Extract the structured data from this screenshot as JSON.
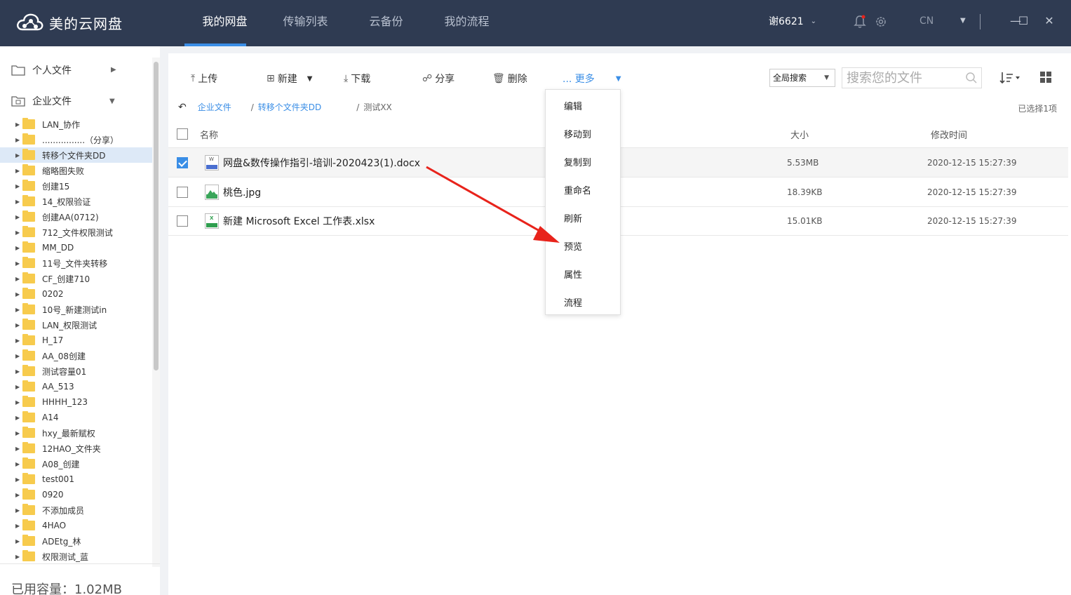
{
  "app": {
    "title": "美的云网盘"
  },
  "nav": [
    {
      "label": "我的网盘",
      "active": true
    },
    {
      "label": "传输列表",
      "active": false
    },
    {
      "label": "云备份",
      "active": false
    },
    {
      "label": "我的流程",
      "active": false
    }
  ],
  "user": {
    "name": "谢6621",
    "lang": "CN"
  },
  "sidebar": {
    "personal": "个人文件",
    "enterprise": "企业文件",
    "folders": [
      "LAN_协作",
      "................（分享）",
      "转移个文件夹DD",
      "缩略图失败",
      "创建15",
      "14_权限验证",
      "创建AA(0712)",
      "712_文件权限测试",
      "MM_DD",
      "11号_文件夹转移",
      "CF_创建710",
      "0202",
      "10号_新建测试in",
      "LAN_权限测试",
      "H_17",
      "AA_08创建",
      "测试容量01",
      "AA_513",
      "HHHH_123",
      "A14",
      "hxy_最新赋权",
      "12HAO_文件夹",
      "A08_创建",
      "test001",
      "0920",
      "不添加成员",
      "4HAO",
      "ADEtg_林",
      "权限测试_蓝"
    ],
    "selected_index": 2,
    "storage": "已用容量：1.02MB"
  },
  "toolbar": {
    "upload": "上传",
    "new": "新建",
    "download": "下载",
    "share": "分享",
    "delete": "删除",
    "more": "... 更多",
    "search_scope": "全局搜索",
    "search_placeholder": "搜索您的文件"
  },
  "breadcrumb": {
    "items": [
      "企业文件",
      "转移个文件夹DD",
      "测试XX"
    ]
  },
  "selected_count": "已选择1项",
  "table": {
    "headers": {
      "name": "名称",
      "size": "大小",
      "modified": "修改时间"
    },
    "rows": [
      {
        "name": "网盘&数传操作指引-培训-2020423(1).docx",
        "size": "5.53MB",
        "modified": "2020-12-15 15:27:39",
        "type": "doc",
        "checked": true
      },
      {
        "name": "桃色.jpg",
        "size": "18.39KB",
        "modified": "2020-12-15 15:27:39",
        "type": "jpg",
        "checked": false
      },
      {
        "name": "新建 Microsoft Excel 工作表.xlsx",
        "size": "15.01KB",
        "modified": "2020-12-15 15:27:39",
        "type": "xls",
        "checked": false
      }
    ]
  },
  "more_menu": [
    "编辑",
    "移动到",
    "复制到",
    "重命名",
    "刷新",
    "预览",
    "属性",
    "流程"
  ],
  "colors": {
    "topbar": "#2f3b52",
    "accent": "#3a8ee6",
    "folder": "#f7cb4d",
    "arrow": "#e8231b"
  }
}
